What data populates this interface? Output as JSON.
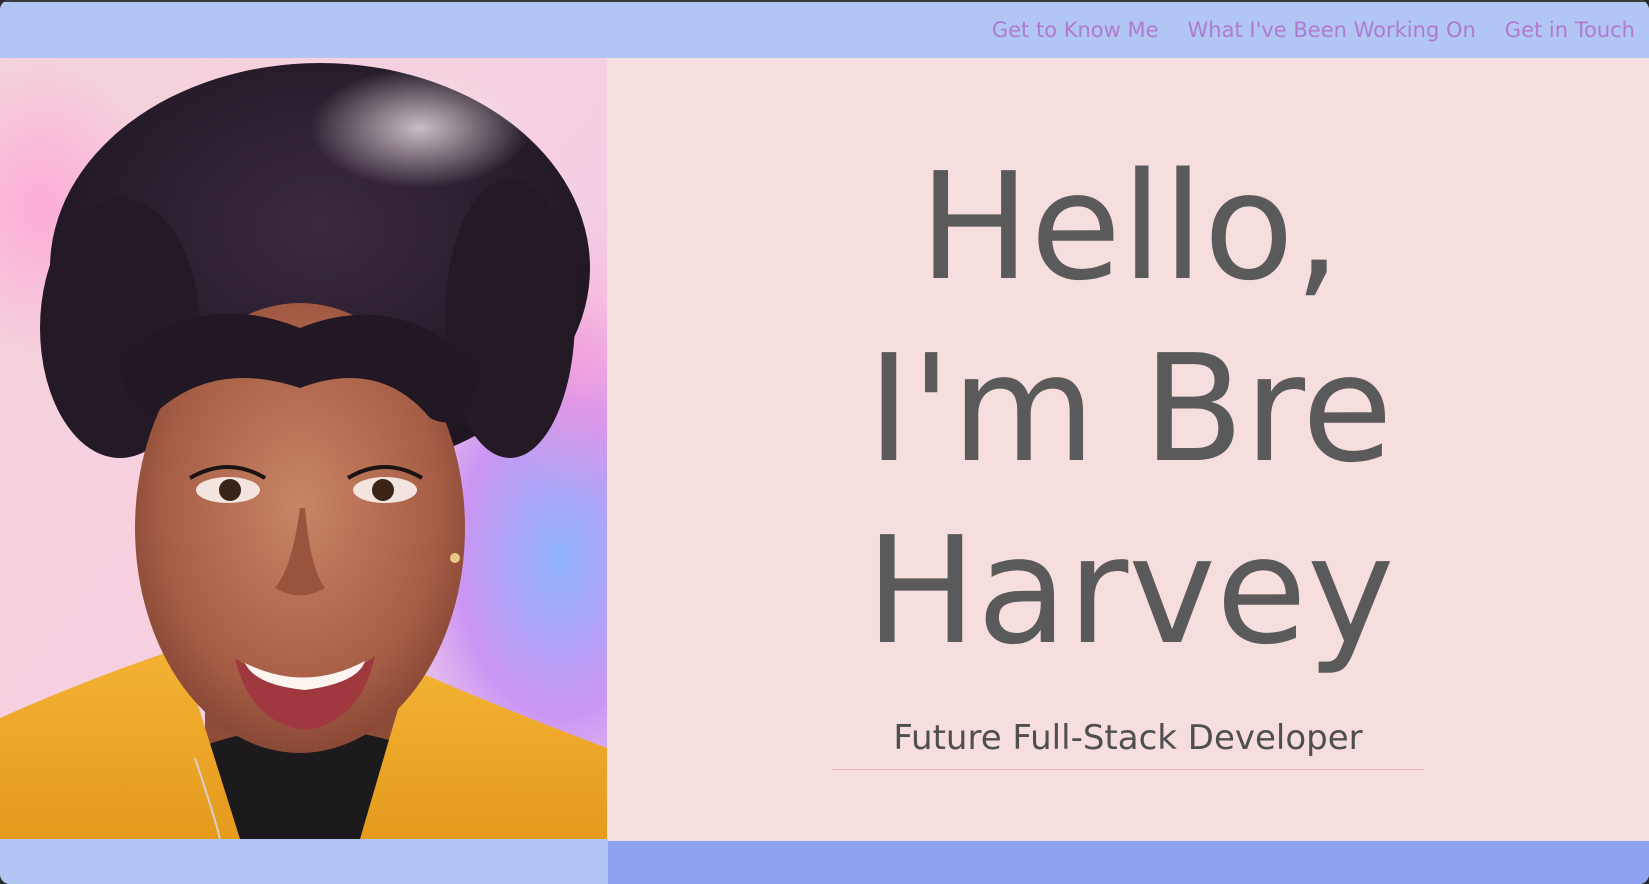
{
  "nav": {
    "items": [
      {
        "label": "Get to Know Me"
      },
      {
        "label": "What I've Been Working On"
      },
      {
        "label": "Get in Touch"
      }
    ]
  },
  "hero": {
    "headline_line1": "Hello,",
    "headline_line2": "I'm Bre",
    "headline_line3": "Harvey",
    "subtitle": "Future Full-Stack Developer"
  },
  "colors": {
    "nav_background": "#b1c6f2",
    "nav_link": "#b07ad1",
    "page_background": "#f7dede",
    "headline": "#5a5a5a",
    "footer_left": "#b1c6f2",
    "footer_right": "#8fa2ef"
  }
}
